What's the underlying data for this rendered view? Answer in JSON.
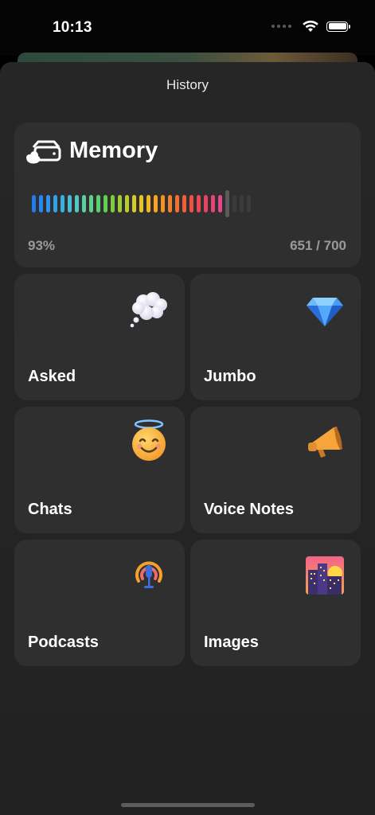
{
  "status_bar": {
    "time": "10:13"
  },
  "sheet": {
    "title": "History"
  },
  "memory": {
    "title": "Memory",
    "percent_label": "93%",
    "count_label": "651 / 700",
    "used": 651,
    "total": 700,
    "bar_colors": [
      "#1e7cf2",
      "#2a86f0",
      "#2f92ee",
      "#35a0ea",
      "#3daee2",
      "#46bcd6",
      "#52c6c2",
      "#5acca6",
      "#5ed08a",
      "#5cd06a",
      "#62cf4e",
      "#7ecb3c",
      "#9ccc34",
      "#b8cd2e",
      "#d2cc2a",
      "#e6c626",
      "#f2b624",
      "#f6a524",
      "#f59226",
      "#f3802b",
      "#f26e32",
      "#f15d3b",
      "#ee5046",
      "#ea4654",
      "#e84264",
      "#e64476",
      "#e0488a",
      "#5a5a5a",
      "#3a3a3a",
      "#3a3a3a",
      "#3a3a3a"
    ],
    "current_index": 27
  },
  "tiles": [
    {
      "label": "Asked",
      "icon": "thought-bubble-icon"
    },
    {
      "label": "Jumbo",
      "icon": "gem-icon"
    },
    {
      "label": "Chats",
      "icon": "halo-smile-icon"
    },
    {
      "label": "Voice Notes",
      "icon": "megaphone-icon"
    },
    {
      "label": "Podcasts",
      "icon": "podcast-icon"
    },
    {
      "label": "Images",
      "icon": "city-sunset-icon"
    }
  ]
}
